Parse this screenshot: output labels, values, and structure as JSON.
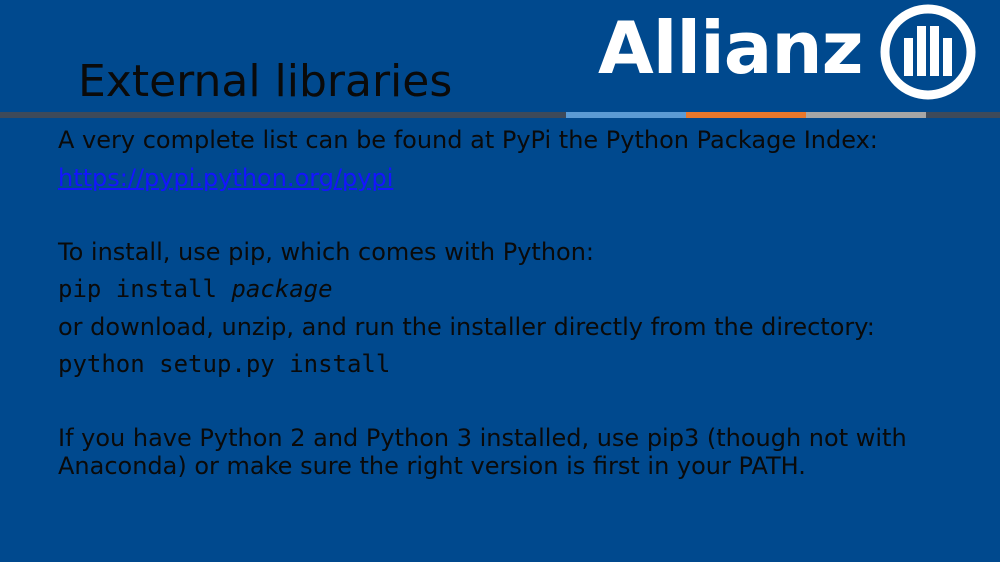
{
  "slide": {
    "title": "External libraries",
    "logo_text": "Allianz",
    "colors": {
      "background": "#00498e",
      "text": "#0a0a0a",
      "link": "#1414ff",
      "logo": "#ffffff",
      "divider": "#3e4a5a",
      "accent_blue": "#5b9bd5",
      "accent_orange": "#e8782c",
      "accent_gray": "#a6a6a6"
    },
    "body": {
      "line1": "A very complete list can be found at PyPi the Python Package Index:",
      "link": "https://pypi.python.org/pypi",
      "line2": "To install, use pip, which comes with Python:",
      "code1_cmd": "pip install ",
      "code1_arg": "package",
      "line3": "or download, unzip, and run the installer directly from the directory:",
      "code2": "python setup.py install",
      "line4": "If you have Python 2 and Python 3 installed, use pip3 (though not with Anaconda) or make sure the right version is first in your PATH."
    },
    "icons": {
      "logo_mark": "allianz-eagle-icon"
    }
  }
}
